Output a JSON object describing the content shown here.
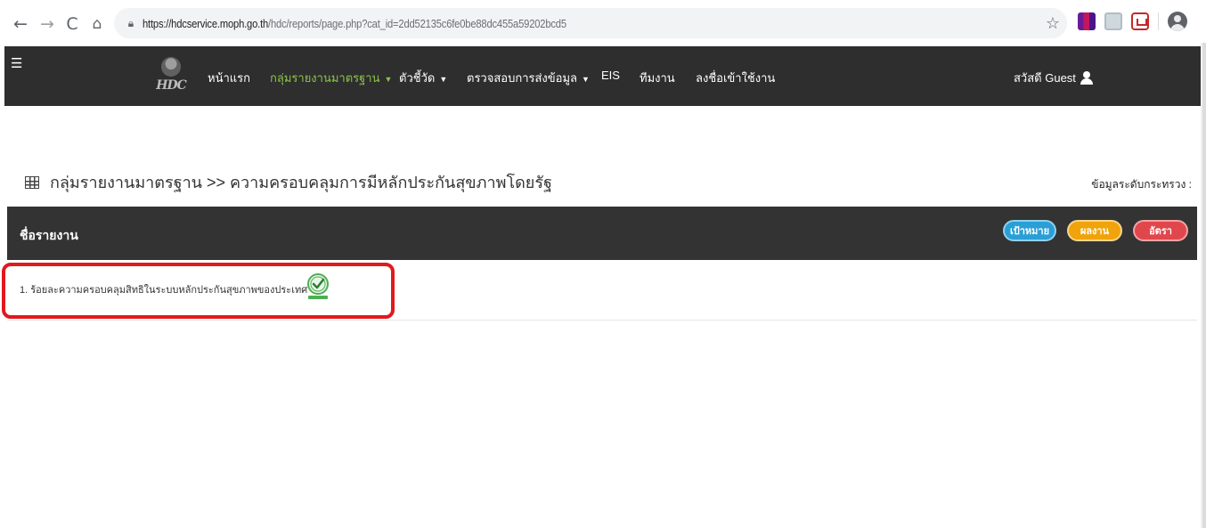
{
  "browser": {
    "url_host": "https://hdcservice.moph.go.th",
    "url_path": "/hdc/reports/page.php?cat_id=2dd52135c6fe0be88dc455a59202bcd5"
  },
  "navbar": {
    "logo_text": "HDC",
    "items": [
      {
        "label": "หน้าแรก"
      },
      {
        "label": "กลุ่มรายงานมาตรฐาน",
        "active": true,
        "dropdown": true
      },
      {
        "label": "ตัวชี้วัด",
        "dropdown": true
      },
      {
        "label": "ตรวจสอบการส่งข้อมูล",
        "dropdown": true
      },
      {
        "label": "EIS"
      },
      {
        "label": "ทีมงาน"
      },
      {
        "label": "ลงชื่อเข้าใช้งาน"
      }
    ],
    "greeting": "สวัสดี Guest"
  },
  "page": {
    "heading": "กลุ่มรายงานมาตรฐาน >> ความครอบคลุมการมีหลักประกันสุขภาพโดยรัฐ",
    "data_level": "ข้อมูลระดับกระทรวง :"
  },
  "report_table": {
    "header_title": "ชื่อรายงาน",
    "buttons": {
      "target": "เป้าหมาย",
      "result": "ผลงาน",
      "rate": "อัตรา"
    },
    "rows": [
      {
        "label": "1. ร้อยละความครอบคลุมสิทธิในระบบหลักประกันสุขภาพของประเทศ"
      }
    ]
  },
  "colors": {
    "navbar_bg": "#2e2e2e",
    "active_nav": "#8bc34a",
    "target_btn": "#2a9fd6",
    "result_btn": "#f0a30a",
    "rate_btn": "#e0474c",
    "highlight": "#e0191e"
  }
}
